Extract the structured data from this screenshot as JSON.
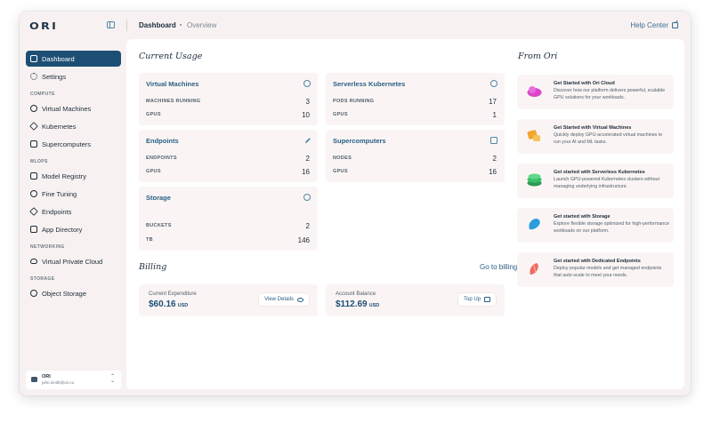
{
  "app": {
    "logo": "ORI"
  },
  "breadcrumb": {
    "current": "Dashboard",
    "sub": "Overview"
  },
  "help": {
    "label": "Help Center"
  },
  "sidebar": {
    "top_items": [
      {
        "label": "Dashboard",
        "icon": "dashboard-icon",
        "active": true
      },
      {
        "label": "Settings",
        "icon": "gear-icon",
        "active": false
      }
    ],
    "sections": [
      {
        "label": "COMPUTE",
        "items": [
          {
            "label": "Virtual Machines",
            "icon": "globe-icon"
          },
          {
            "label": "Kubernetes",
            "icon": "kubernetes-icon"
          },
          {
            "label": "Supercomputers",
            "icon": "chip-icon"
          }
        ]
      },
      {
        "label": "MLOPS",
        "items": [
          {
            "label": "Model Registry",
            "icon": "grid-icon"
          },
          {
            "label": "Fine Tuning",
            "icon": "tuning-icon"
          },
          {
            "label": "Endpoints",
            "icon": "bolt-icon"
          },
          {
            "label": "App Directory",
            "icon": "apps-icon"
          }
        ]
      },
      {
        "label": "NETWORKING",
        "items": [
          {
            "label": "Virtual Private Cloud",
            "icon": "cloud-icon"
          }
        ]
      },
      {
        "label": "STORAGE",
        "items": [
          {
            "label": "Object Storage",
            "icon": "box-icon"
          }
        ]
      }
    ],
    "user": {
      "name": "ORI",
      "email": "john.smith@ori.co"
    }
  },
  "usage": {
    "heading": "Current Usage",
    "cards": [
      {
        "title": "Virtual Machines",
        "icon": "globe-icon",
        "rows": [
          {
            "label": "MACHINES RUNNING",
            "value": "3"
          },
          {
            "label": "GPUS",
            "value": "10"
          }
        ]
      },
      {
        "title": "Serverless Kubernetes",
        "icon": "kubernetes-icon",
        "rows": [
          {
            "label": "PODS RUNNING",
            "value": "17"
          },
          {
            "label": "GPUS",
            "value": "1"
          }
        ]
      },
      {
        "title": "Endpoints",
        "icon": "bolt-icon",
        "rows": [
          {
            "label": "ENDPOINTS",
            "value": "2"
          },
          {
            "label": "GPUS",
            "value": "16"
          }
        ]
      },
      {
        "title": "Supercomputers",
        "icon": "server-icon",
        "rows": [
          {
            "label": "NODES",
            "value": "2"
          },
          {
            "label": "GPUS",
            "value": "16"
          }
        ]
      },
      {
        "title": "Storage",
        "icon": "box-icon",
        "rows": [
          {
            "label": "BUCKETS",
            "value": "2"
          },
          {
            "label": "TB",
            "value": "146"
          }
        ]
      }
    ]
  },
  "billing": {
    "heading": "Billing",
    "link": "Go to billing",
    "cards": [
      {
        "label": "Current Expenditure",
        "amount": "$60.16",
        "currency": "USD",
        "button": "View Details"
      },
      {
        "label": "Account Balance",
        "amount": "$112.69",
        "currency": "USD",
        "button": "Top Up"
      }
    ]
  },
  "from_ori": {
    "heading": "From Ori",
    "items": [
      {
        "title": "Get Started with Ori Cloud",
        "desc": "Discover how our platform delivers powerful, scalable GPU solutions for your workloads.",
        "color": "#d946c8"
      },
      {
        "title": "Get Started with Virtual Machines",
        "desc": "Quickly deploy GPU-accelerated virtual machines to run your AI and ML tasks.",
        "color": "#f2a52b"
      },
      {
        "title": "Get started with Serverless Kubernetes",
        "desc": "Launch GPU-powered Kubernetes clusters without managing underlying infrastructure.",
        "color": "#3cbf6a"
      },
      {
        "title": "Get started with Storage",
        "desc": "Explore flexible storage optimized for high-performance workloads on our platform.",
        "color": "#2d9be0"
      },
      {
        "title": "Get started with Dedicated Endpoints",
        "desc": "Deploy popular models and get managed endpoints that auto-scale to meet your needs.",
        "color": "#ef6b63"
      }
    ]
  },
  "colors": {
    "primary": "#1d4f75",
    "accent": "#2a5f86",
    "panel": "#faf5f4"
  }
}
